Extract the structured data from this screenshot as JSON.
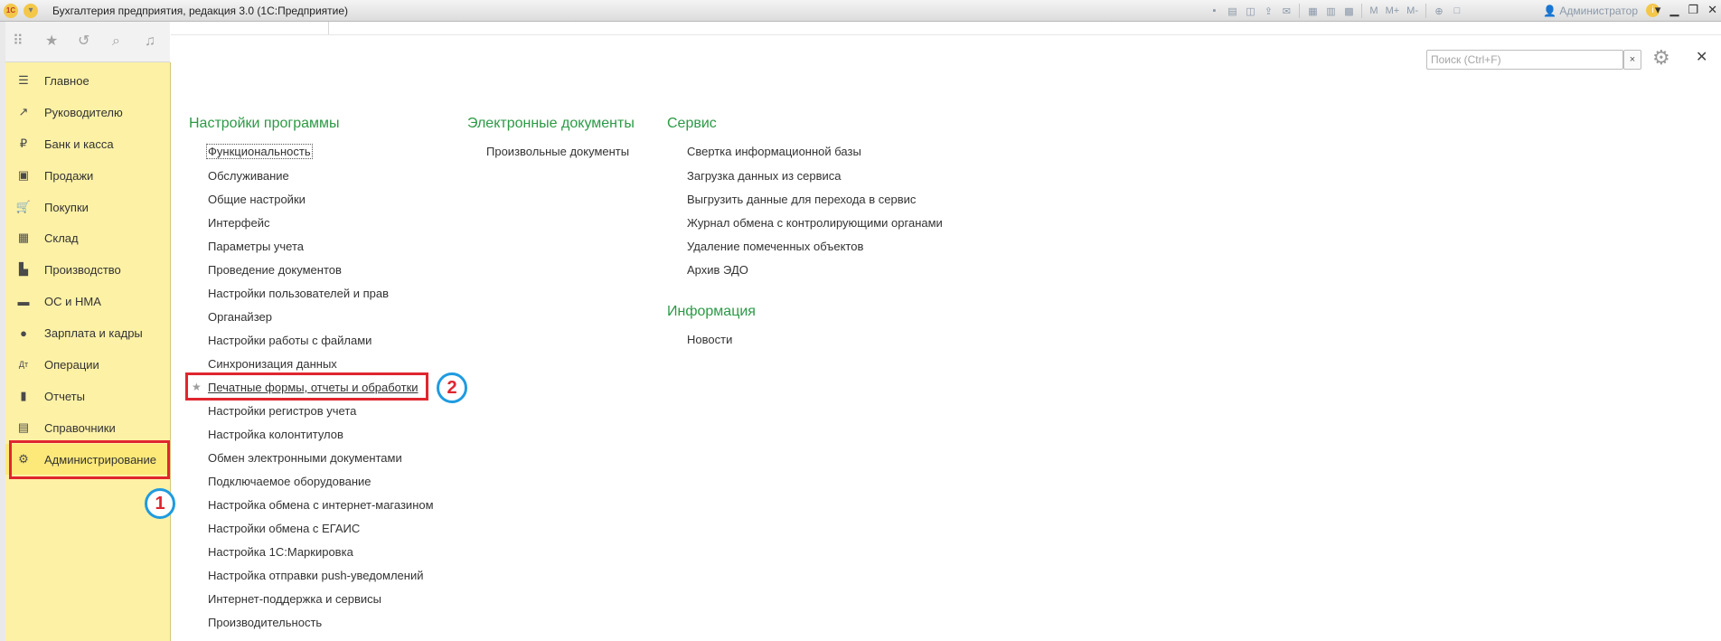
{
  "window": {
    "title": "Бухгалтерия предприятия, редакция 3.0  (1С:Предприятие)",
    "logo_text": "1С",
    "user": "Администратор",
    "memory_buttons": [
      "M",
      "M+",
      "M-"
    ]
  },
  "sidebar": {
    "items": [
      {
        "label": "Главное",
        "icon": "list-icon",
        "glyph": "☰"
      },
      {
        "label": "Руководителю",
        "icon": "trend-icon",
        "glyph": "↗"
      },
      {
        "label": "Банк и касса",
        "icon": "coin-icon",
        "glyph": "₽"
      },
      {
        "label": "Продажи",
        "icon": "bag-icon",
        "glyph": "▣"
      },
      {
        "label": "Покупки",
        "icon": "cart-icon",
        "glyph": "🛒"
      },
      {
        "label": "Склад",
        "icon": "warehouse-icon",
        "glyph": "▦"
      },
      {
        "label": "Производство",
        "icon": "factory-icon",
        "glyph": "▙"
      },
      {
        "label": "ОС и НМА",
        "icon": "truck-icon",
        "glyph": "▬"
      },
      {
        "label": "Зарплата и кадры",
        "icon": "person-icon",
        "glyph": "●"
      },
      {
        "label": "Операции",
        "icon": "ledger-icon",
        "glyph": "Дт"
      },
      {
        "label": "Отчеты",
        "icon": "bar-chart-icon",
        "glyph": "▮"
      },
      {
        "label": "Справочники",
        "icon": "books-icon",
        "glyph": "▤"
      },
      {
        "label": "Администрирование",
        "icon": "gear-icon",
        "glyph": "⚙"
      }
    ],
    "active_index": 12
  },
  "search": {
    "placeholder": "Поиск (Ctrl+F)",
    "clear_glyph": "×"
  },
  "sections": {
    "program_settings": {
      "title": "Настройки программы",
      "links": [
        "Функциональность",
        "Обслуживание",
        "Общие настройки",
        "Интерфейс",
        "Параметры учета",
        "Проведение документов",
        "Настройки пользователей и прав",
        "Органайзер",
        "Настройки работы с файлами",
        "Синхронизация данных",
        "Печатные формы, отчеты и обработки",
        "Настройки регистров учета",
        "Настройка колонтитулов",
        "Обмен электронными документами",
        "Подключаемое оборудование",
        "Настройка обмена с интернет-магазином",
        "Настройки обмена с ЕГАИС",
        "Настройка 1С:Маркировка",
        "Настройка отправки push-уведомлений",
        "Интернет-поддержка и сервисы",
        "Производительность"
      ]
    },
    "edocs": {
      "title": "Электронные документы",
      "links": [
        "Произвольные документы"
      ]
    },
    "service": {
      "title": "Сервис",
      "links": [
        "Свертка информационной базы",
        "Загрузка данных из сервиса",
        "Выгрузить данные для перехода в сервис",
        "Журнал обмена с контролирующими органами",
        "Удаление помеченных объектов",
        "Архив ЭДО"
      ]
    },
    "info": {
      "title": "Информация",
      "links": [
        "Новости"
      ]
    }
  },
  "annotations": {
    "badge1": "1",
    "badge2": "2"
  },
  "colors": {
    "sidebar_bg": "#fdf1a6",
    "section_title": "#2b9a45",
    "highlight": "#e0262f",
    "badge_ring": "#1f9be0"
  }
}
